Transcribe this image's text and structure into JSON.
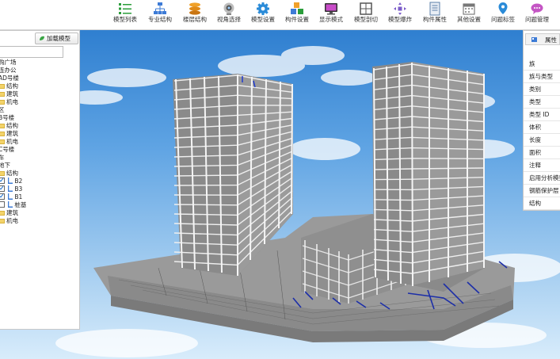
{
  "toolbar": {
    "items": [
      {
        "label": "模型列表",
        "icon": "list-icon"
      },
      {
        "label": "专业结构",
        "icon": "tree-structure-icon"
      },
      {
        "label": "楼层结构",
        "icon": "layers-icon"
      },
      {
        "label": "视角选择",
        "icon": "camera-icon"
      },
      {
        "label": "模型设置",
        "icon": "gear-icon"
      },
      {
        "label": "构件设置",
        "icon": "cubes-icon"
      },
      {
        "label": "显示模式",
        "icon": "monitor-icon"
      },
      {
        "label": "模型剖切",
        "icon": "section-box-icon"
      },
      {
        "label": "模型爆炸",
        "icon": "explode-icon"
      },
      {
        "label": "构件属性",
        "icon": "document-icon"
      },
      {
        "label": "其他设置",
        "icon": "calendar-icon"
      },
      {
        "label": "问题标签",
        "icon": "map-pin-icon"
      },
      {
        "label": "问题管理",
        "icon": "speech-bubble-icon"
      }
    ]
  },
  "left_panel": {
    "load_button": "加载模型",
    "search_value": "",
    "tree": [
      {
        "label": "购广场",
        "kind": "text"
      },
      {
        "label": "连办公",
        "kind": "text"
      },
      {
        "label": "AD号楼",
        "kind": "text"
      },
      {
        "label": "结构",
        "kind": "folder"
      },
      {
        "label": "建筑",
        "kind": "folder"
      },
      {
        "label": "机电",
        "kind": "folder"
      },
      {
        "label": "区",
        "kind": "text"
      },
      {
        "label": "B号楼",
        "kind": "text"
      },
      {
        "label": "结构",
        "kind": "folder"
      },
      {
        "label": "建筑",
        "kind": "folder"
      },
      {
        "label": "机电",
        "kind": "folder"
      },
      {
        "label": "C号楼",
        "kind": "text"
      },
      {
        "label": "车",
        "kind": "text"
      },
      {
        "label": "地下",
        "kind": "text"
      },
      {
        "label": "结构",
        "kind": "folder"
      },
      {
        "label": "B2",
        "kind": "level",
        "checked": true
      },
      {
        "label": "B3",
        "kind": "level",
        "checked": true
      },
      {
        "label": "B1",
        "kind": "level",
        "checked": true
      },
      {
        "label": "桩基",
        "kind": "level",
        "checked": false
      },
      {
        "label": "建筑",
        "kind": "folder"
      },
      {
        "label": "机电",
        "kind": "folder"
      }
    ]
  },
  "right_panel": {
    "title": "属性",
    "rows": [
      "族",
      "族与类型",
      "类别",
      "类型",
      "类型 ID",
      "体积",
      "长度",
      "面积",
      "注释",
      "启用分析模型",
      "钢筋保护层",
      "结构"
    ]
  },
  "colors": {
    "sky_top": "#2f7fd0",
    "sky_bottom": "#d8ecfb",
    "concrete": "#8c8c8c",
    "beam": "#dedede",
    "accent_blue": "#1a6fcf"
  }
}
